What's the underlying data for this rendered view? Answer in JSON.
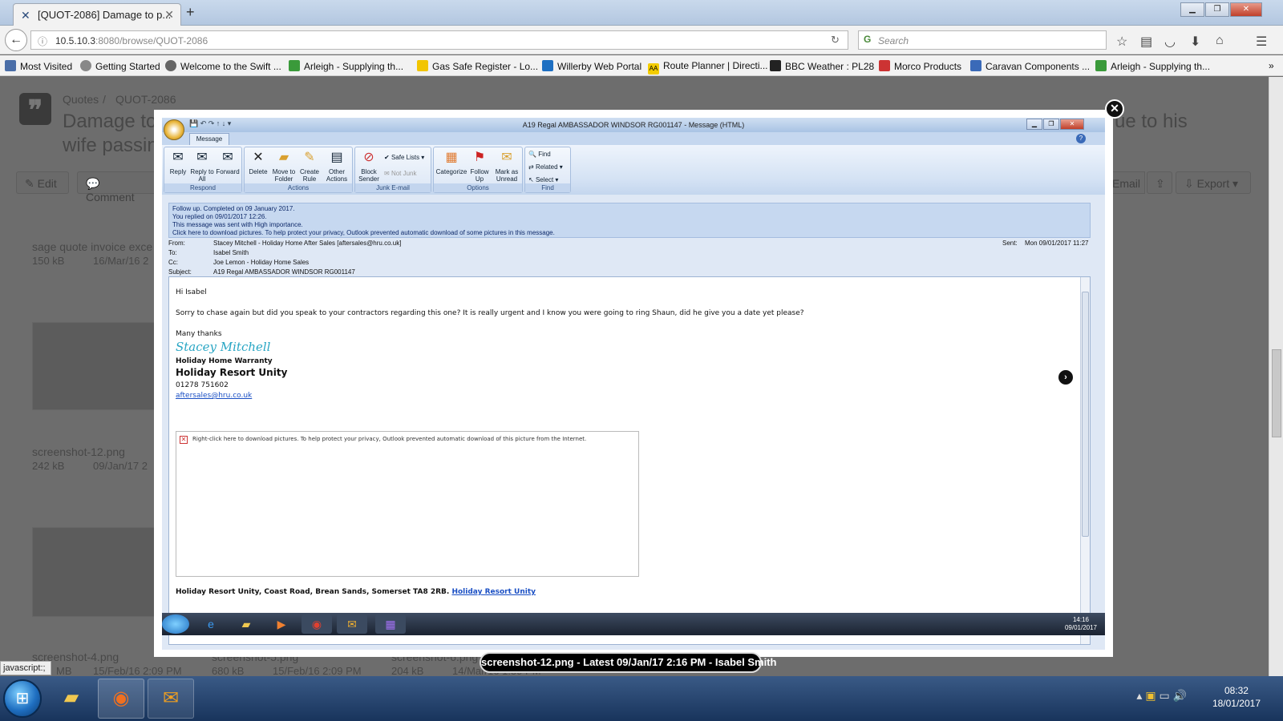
{
  "browser": {
    "tab_title": "[QUOT-2086] Damage to p...",
    "url_host": "10.5.10.3",
    "url_path": ":8080/browse/QUOT-2086",
    "search_placeholder": "Search",
    "bookmarks": [
      "Most Visited",
      "Getting Started",
      "Welcome to the Swift ...",
      "Arleigh - Supplying th...",
      "Gas Safe Register - Lo...",
      "Willerby Web Portal",
      "Route Planner | Directi...",
      "BBC Weather : PL28",
      "Morco Products",
      "Caravan Components ...",
      "Arleigh - Supplying th..."
    ]
  },
  "page": {
    "breadcrumb_quotes": "Quotes",
    "breadcrumb_sep": "/",
    "breadcrumb_issue": "QUOT-2086",
    "title_line1": "Damage to",
    "title_line2": "wife passin",
    "title_right": "ue to his",
    "edit_label": "Edit",
    "comment_label": "Comment",
    "email_label": "Email",
    "export_label": "Export",
    "attachments": [
      {
        "name": "sage quote invoice exce",
        "size": "150 kB",
        "date": "16/Mar/16 2"
      },
      {
        "name": "screenshot-12.png",
        "size": "242 kB",
        "date": "09/Jan/17 2"
      },
      {
        "name": "screenshot-4.png",
        "size": "MB",
        "date": "15/Feb/16 2:09 PM"
      },
      {
        "name": "screenshot-5.png",
        "size": "680 kB",
        "date": "15/Feb/16 2:09 PM"
      },
      {
        "name": "screenshot-6.png",
        "size": "204 kB",
        "date": "14/Mar/16 1:59 PM"
      }
    ]
  },
  "outlook": {
    "window_title": "A19 Regal AMBASSADOR WINDSOR RG001147 - Message (HTML)",
    "tab_message": "Message",
    "ribbon": {
      "respond": {
        "label": "Respond",
        "reply": "Reply",
        "reply_all": "Reply to All",
        "forward": "Forward"
      },
      "actions": {
        "label": "Actions",
        "delete": "Delete",
        "move": "Move to Folder",
        "rule": "Create Rule",
        "other": "Other Actions"
      },
      "junk": {
        "label": "Junk E-mail",
        "block": "Block Sender",
        "safe": "Safe Lists",
        "not_junk": "Not Junk"
      },
      "options": {
        "label": "Options",
        "categorize": "Categorize",
        "follow": "Follow Up",
        "mark": "Mark as Unread"
      },
      "find": {
        "label": "Find",
        "find": "Find",
        "related": "Related",
        "select": "Select"
      }
    },
    "info_lines": [
      "Follow up.  Completed on 09 January 2017.",
      "You replied on 09/01/2017 12:26.",
      "This message was sent with High importance.",
      "Click here to download pictures. To help protect your privacy, Outlook prevented automatic download of some pictures in this message."
    ],
    "headers": {
      "from_label": "From:",
      "from": "Stacey Mitchell - Holiday Home After Sales [aftersales@hru.co.uk]",
      "to_label": "To:",
      "to": "Isabel Smith",
      "cc_label": "Cc:",
      "cc": "Joe Lemon - Holiday Home Sales",
      "subject_label": "Subject:",
      "subject": "A19 Regal AMBASSADOR WINDSOR RG001147",
      "sent_label": "Sent:",
      "sent": "Mon 09/01/2017 11:27"
    },
    "body": {
      "greeting": "Hi Isabel",
      "message": "Sorry to chase again but did you speak to your contractors regarding this one? It is really urgent and I know you were going to ring Shaun, did he give you a date yet please?",
      "thanks": "Many thanks",
      "signature": "Stacey Mitchell",
      "dept": "Holiday Home Warranty",
      "company": "Holiday Resort Unity",
      "phone": "01278 751602",
      "email": "aftersales@hru.co.uk",
      "image_blocked": "Right-click here to download pictures.  To help protect your privacy, Outlook prevented automatic download of this picture from the Internet.",
      "footer": "Holiday Resort Unity, Coast Road, Brean Sands, Somerset TA8 2RB.",
      "footer_link": "Holiday Resort Unity"
    },
    "inner_clock_time": "14:16",
    "inner_clock_date": "09/01/2017"
  },
  "caption": "screenshot-12.png - Latest 09/Jan/17 2:16 PM - Isabel Smith",
  "status_text": "javascript:;",
  "taskbar": {
    "time": "08:32",
    "date": "18/01/2017"
  },
  "colors": {
    "accent": "#29a6c4",
    "link": "#1a4fc4",
    "ribbon": "#d4e2f4"
  }
}
